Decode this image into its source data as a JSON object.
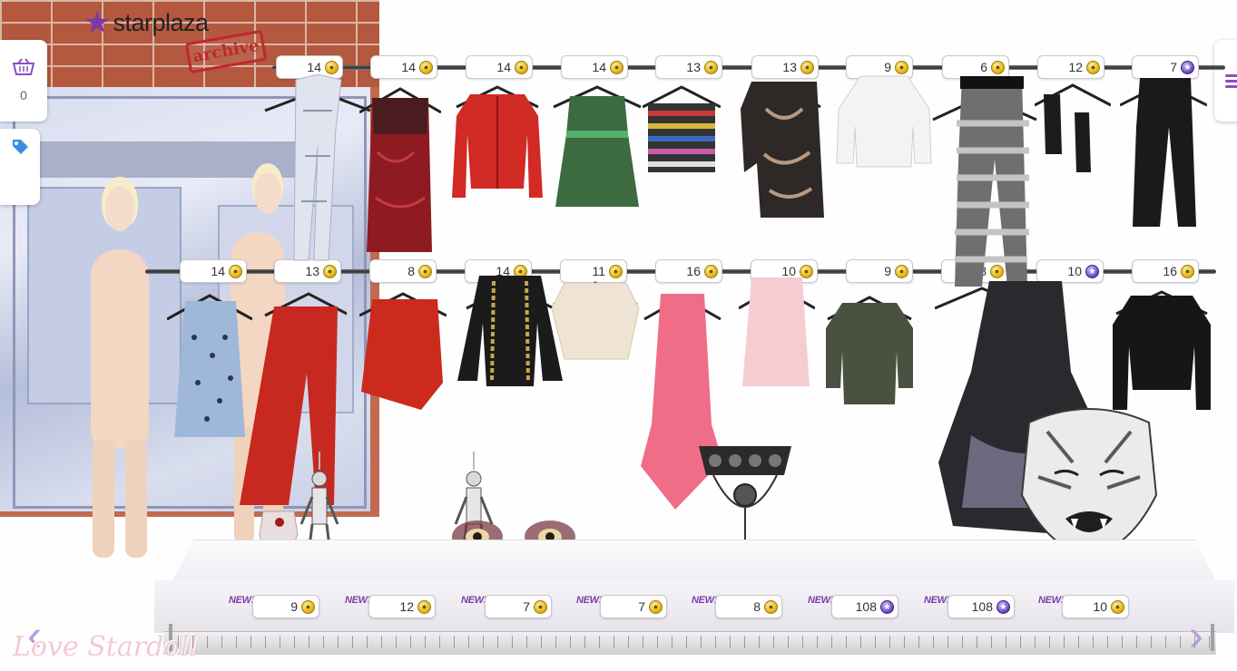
{
  "header": {
    "logo_text": "starplaza",
    "stamp_text": "archive"
  },
  "sidebar": {
    "basket_count": "0"
  },
  "rack_top": {
    "prices": [
      {
        "value": "14",
        "currency": "coin"
      },
      {
        "value": "14",
        "currency": "coin"
      },
      {
        "value": "14",
        "currency": "coin"
      },
      {
        "value": "14",
        "currency": "coin"
      },
      {
        "value": "13",
        "currency": "coin"
      },
      {
        "value": "13",
        "currency": "coin"
      },
      {
        "value": "9",
        "currency": "coin"
      },
      {
        "value": "6",
        "currency": "coin"
      },
      {
        "value": "12",
        "currency": "coin"
      },
      {
        "value": "7",
        "currency": "stardollar"
      }
    ]
  },
  "rack_middle": {
    "prices": [
      {
        "value": "14",
        "currency": "coin"
      },
      {
        "value": "13",
        "currency": "coin"
      },
      {
        "value": "8",
        "currency": "coin"
      },
      {
        "value": "14",
        "currency": "coin"
      },
      {
        "value": "11",
        "currency": "coin"
      },
      {
        "value": "16",
        "currency": "coin"
      },
      {
        "value": "10",
        "currency": "coin"
      },
      {
        "value": "9",
        "currency": "coin"
      },
      {
        "value": "8",
        "currency": "coin"
      },
      {
        "value": "10",
        "currency": "stardollar"
      },
      {
        "value": "16",
        "currency": "coin"
      }
    ]
  },
  "table": {
    "new_label": "NEW!",
    "prices": [
      {
        "value": "9",
        "currency": "coin"
      },
      {
        "value": "12",
        "currency": "coin"
      },
      {
        "value": "7",
        "currency": "coin"
      },
      {
        "value": "7",
        "currency": "coin"
      },
      {
        "value": "8",
        "currency": "coin"
      },
      {
        "value": "108",
        "currency": "stardollar"
      },
      {
        "value": "108",
        "currency": "stardollar"
      },
      {
        "value": "10",
        "currency": "coin"
      }
    ]
  },
  "watermark": "Love Stardoll",
  "colors": {
    "accent": "#7a3aa8",
    "coin": "#e4b716",
    "stardollar": "#6b48c9",
    "brick": "#b4583f"
  },
  "icons": {
    "basket": "basket-icon",
    "tag": "tag-icon",
    "menu": "menu-icon",
    "prev": "chevron-left-icon",
    "next": "chevron-right-icon"
  }
}
